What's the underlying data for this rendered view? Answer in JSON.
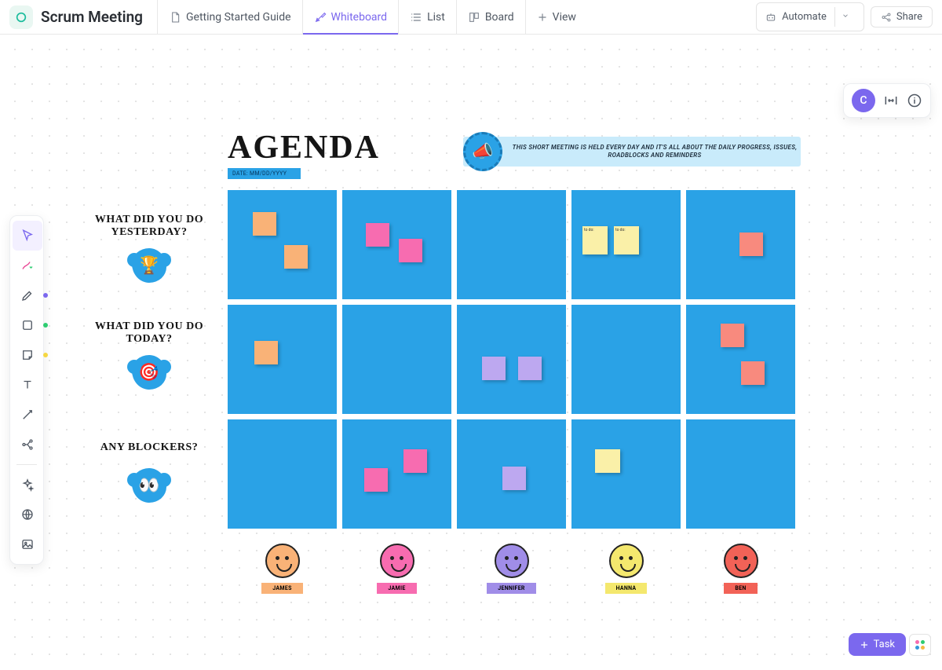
{
  "header": {
    "title": "Scrum Meeting",
    "views": [
      {
        "label": "Getting Started Guide",
        "icon": "doc"
      },
      {
        "label": "Whiteboard",
        "icon": "whiteboard",
        "active": true
      },
      {
        "label": "List",
        "icon": "list"
      },
      {
        "label": "Board",
        "icon": "board"
      }
    ],
    "add_view_label": "View",
    "automate_label": "Automate",
    "share_label": "Share"
  },
  "user": {
    "initial": "C"
  },
  "whiteboard": {
    "title": "AGENDA",
    "date_label": "DATE: MM/DD/YYYY",
    "banner_text": "THIS SHORT MEETING IS HELD EVERY DAY AND IT'S ALL ABOUT THE DAILY PROGRESS, ISSUES, ROADBLOCKS AND REMINDERS",
    "rows": [
      {
        "label": "WHAT DID YOU DO YESTERDAY?",
        "emoji": "🏆"
      },
      {
        "label": "WHAT DID YOU DO TODAY?",
        "emoji": "🎯"
      },
      {
        "label": "ANY BLOCKERS?",
        "emoji": "👀"
      }
    ],
    "people": [
      {
        "name": "JAMES",
        "face": "#f9b277",
        "tag": "#f9b277"
      },
      {
        "name": "JAMIE",
        "face": "#f76cb0",
        "tag": "#f76cb0"
      },
      {
        "name": "JENNIFER",
        "face": "#a08de8",
        "tag": "#a08de8"
      },
      {
        "name": "HANNA",
        "face": "#f4e86e",
        "tag": "#f4e86e"
      },
      {
        "name": "BEN",
        "face": "#f26257",
        "tag": "#f26257"
      }
    ]
  },
  "task_button": {
    "label": "Task"
  },
  "toolbar_dots": {
    "pen": "#7b68ee",
    "shape": "#2ecc71",
    "note": "#f5d742"
  }
}
